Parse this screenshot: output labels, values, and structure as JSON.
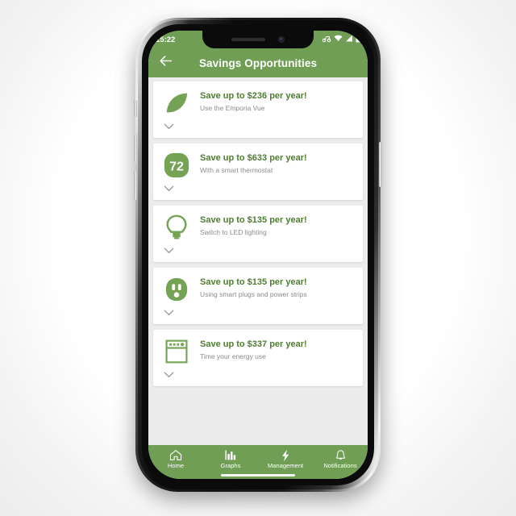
{
  "device": {
    "statusbar": {
      "time": "15:22",
      "icons": [
        "location-icon",
        "wifi-icon",
        "signal-icon",
        "battery-icon"
      ]
    },
    "home_indicator": "home-indicator"
  },
  "appbar": {
    "back_icon": "arrow-left-icon",
    "title": "Savings Opportunities"
  },
  "cards": [
    {
      "icon": "leaf-icon",
      "title": "Save up to $236 per year!",
      "subtitle": "Use the Emporia Vue",
      "expand_icon": "chevron-down-icon"
    },
    {
      "icon": "thermostat-icon",
      "icon_value": "72",
      "title": "Save up to $633 per year!",
      "subtitle": "With a smart thermostat",
      "expand_icon": "chevron-down-icon"
    },
    {
      "icon": "lightbulb-icon",
      "title": "Save up to $135 per year!",
      "subtitle": "Switch to LED lighting",
      "expand_icon": "chevron-down-icon"
    },
    {
      "icon": "power-outlet-icon",
      "title": "Save up to $135 per year!",
      "subtitle": "Using smart plugs and power strips",
      "expand_icon": "chevron-down-icon"
    },
    {
      "icon": "oven-icon",
      "title": "Save up to $337 per year!",
      "subtitle": "Time your energy use",
      "expand_icon": "chevron-down-icon"
    }
  ],
  "bottom_nav": {
    "items": [
      {
        "label": "Home",
        "icon": "house-icon",
        "active": false
      },
      {
        "label": "Graphs",
        "icon": "bar-chart-icon",
        "active": false
      },
      {
        "label": "Management",
        "icon": "lightning-bolt-icon",
        "active": true
      },
      {
        "label": "Notifications",
        "icon": "bell-icon",
        "active": false
      }
    ]
  },
  "colors": {
    "brand_green": "#6f9e54",
    "title_green": "#4f7d31",
    "icon_green": "#74a356",
    "subtitle_gray": "#8b8b8b",
    "page_background": "#ececec",
    "card_background": "#ffffff"
  }
}
